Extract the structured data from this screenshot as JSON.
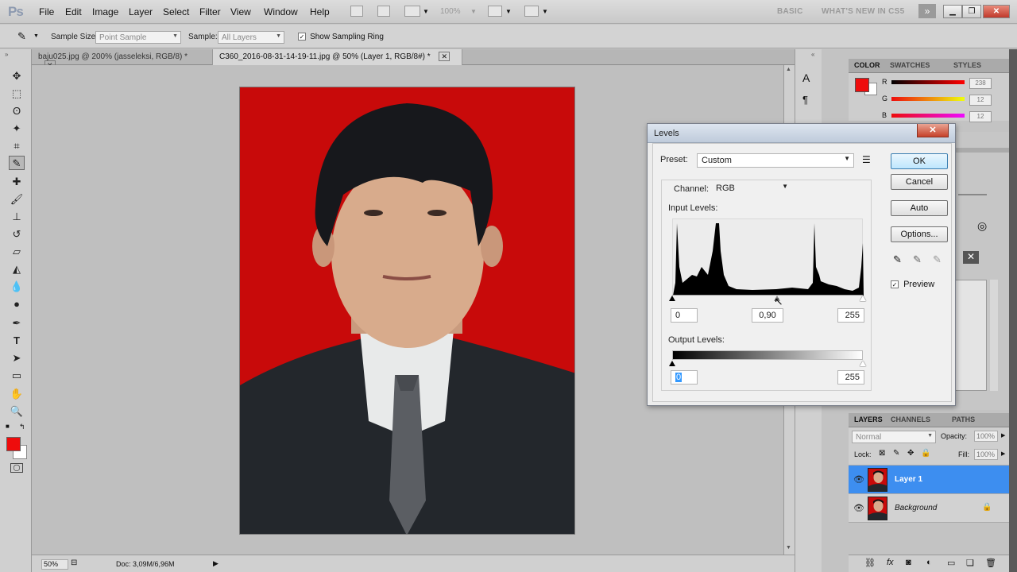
{
  "app": {
    "logo": "Ps",
    "menu": [
      "File",
      "Edit",
      "Image",
      "Layer",
      "Select",
      "Filter",
      "View",
      "Window",
      "Help"
    ],
    "zoom_dropdown": "100%",
    "workspace": [
      "BASIC",
      "WHAT'S NEW IN CS5"
    ],
    "expand": "»"
  },
  "options_bar": {
    "sample_size_label": "Sample Size:",
    "sample_size_value": "Point Sample",
    "sample_label": "Sample:",
    "sample_value": "All Layers",
    "show_ring_label": "Show Sampling Ring",
    "show_ring_checked": "✓"
  },
  "tabs": [
    {
      "label": "baju025.jpg @ 200% (jasseleksi, RGB/8) *",
      "close": "✕"
    },
    {
      "label": "C360_2016-08-31-14-19-11.jpg @ 50% (Layer 1, RGB/8#) *",
      "close": "✕"
    }
  ],
  "status": {
    "zoom": "50%",
    "doc": "Doc: 3,09M/6,96M"
  },
  "color_panel": {
    "tabs": [
      "COLOR",
      "SWATCHES",
      "STYLES"
    ],
    "r_label": "R",
    "g_label": "G",
    "b_label": "B",
    "r": "238",
    "g": "12",
    "b": "12",
    "fg_color": "#ee0c0c"
  },
  "layers_panel": {
    "tabs": [
      "LAYERS",
      "CHANNELS",
      "PATHS"
    ],
    "blend_mode": "Normal",
    "opacity_label": "Opacity:",
    "opacity": "100%",
    "lock_label": "Lock:",
    "fill_label": "Fill:",
    "fill": "100%",
    "layers": [
      {
        "name": "Layer 1",
        "selected": true
      },
      {
        "name": "Background",
        "locked": true
      }
    ]
  },
  "levels": {
    "title": "Levels",
    "close": "✕",
    "preset_label": "Preset:",
    "preset_value": "Custom",
    "channel_label": "Channel:",
    "channel_value": "RGB",
    "input_label": "Input Levels:",
    "input_black": "0",
    "input_gamma": "0,90",
    "input_white": "255",
    "output_label": "Output Levels:",
    "output_black": "0",
    "output_white": "255",
    "ok": "OK",
    "cancel": "Cancel",
    "auto": "Auto",
    "options": "Options...",
    "preview_label": "Preview",
    "preview_checked": "✓"
  }
}
